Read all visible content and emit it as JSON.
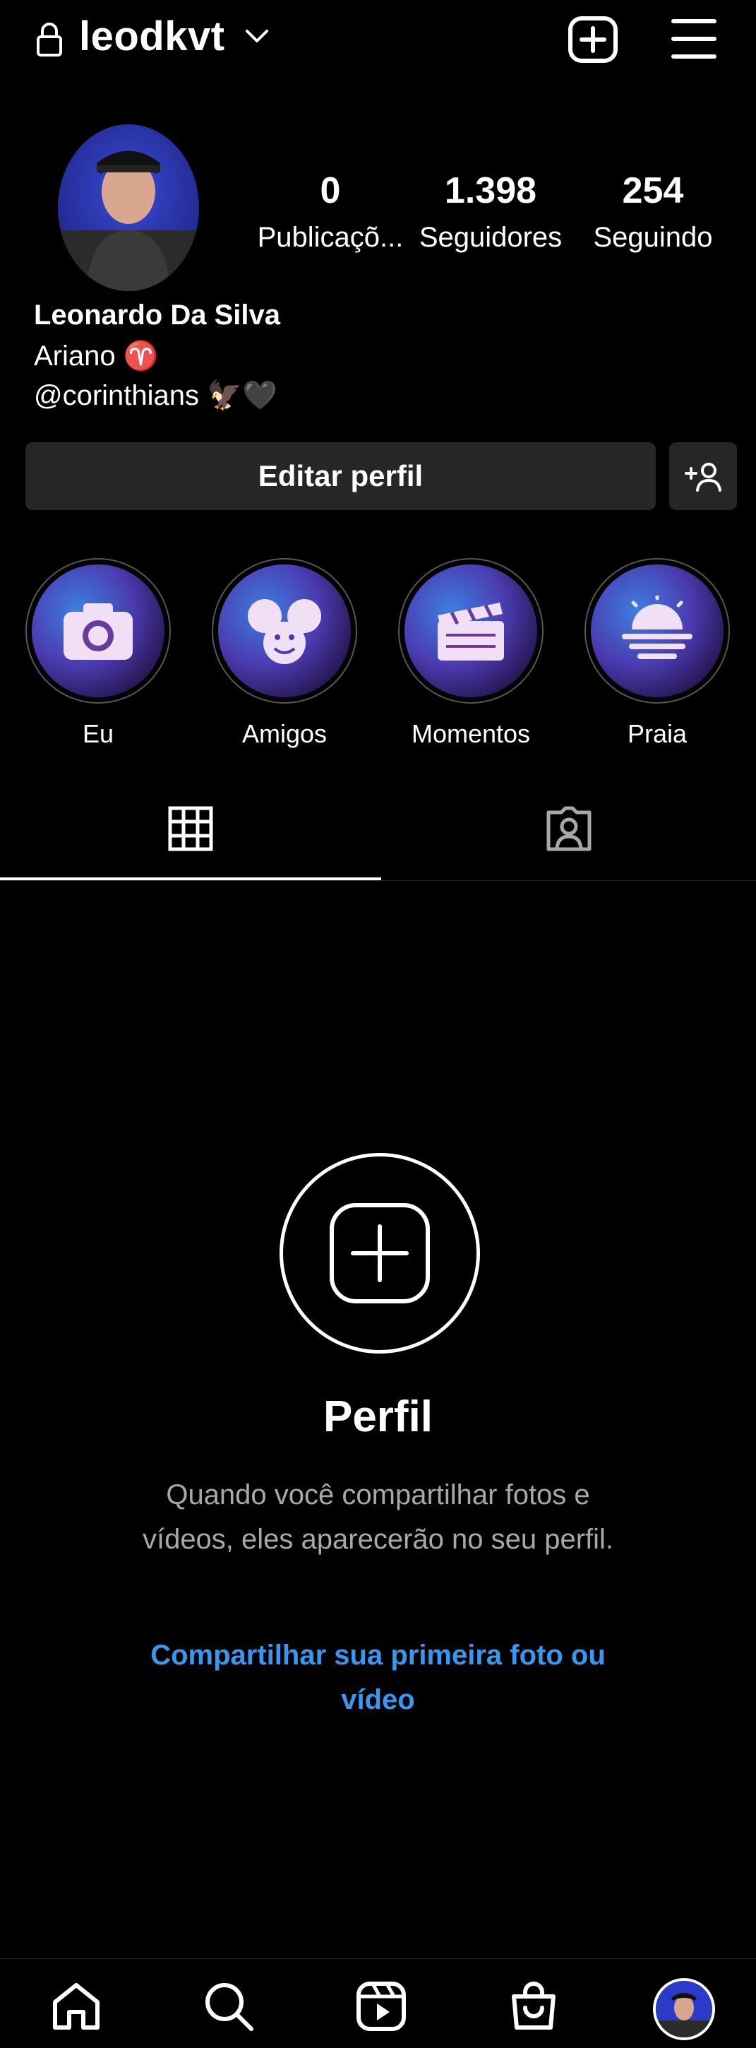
{
  "header": {
    "username": "leodkvt",
    "icons": [
      "lock-icon",
      "chevron-down-icon",
      "new-post-icon",
      "menu-icon"
    ]
  },
  "profile": {
    "stats": [
      {
        "value": "0",
        "label": "Publicaçõ..."
      },
      {
        "value": "1.398",
        "label": "Seguidores"
      },
      {
        "value": "254",
        "label": "Seguindo"
      }
    ],
    "name": "Leonardo Da Silva",
    "bio_line1": "Ariano ♈",
    "bio_line2": "@corinthians 🦅🖤"
  },
  "actions": {
    "edit_label": "Editar perfil",
    "add_friend_icon": "person-add-icon"
  },
  "highlights": [
    {
      "label": "Eu",
      "icon": "camera-icon"
    },
    {
      "label": "Amigos",
      "icon": "friends-icon"
    },
    {
      "label": "Momentos",
      "icon": "clapperboard-icon"
    },
    {
      "label": "Praia",
      "icon": "sunset-icon"
    }
  ],
  "tabs": [
    "grid-icon",
    "tagged-icon"
  ],
  "empty_state": {
    "title": "Perfil",
    "description": "Quando você compartilhar fotos e vídeos, eles aparecerão no seu perfil.",
    "link": "Compartilhar sua primeira foto ou vídeo"
  },
  "bottom_nav": [
    "home-icon",
    "search-icon",
    "reels-icon",
    "shop-icon",
    "profile-avatar"
  ],
  "colors": {
    "background": "#000000",
    "button": "#262626",
    "link": "#3897f0",
    "muted_text": "#a8a8a8"
  }
}
